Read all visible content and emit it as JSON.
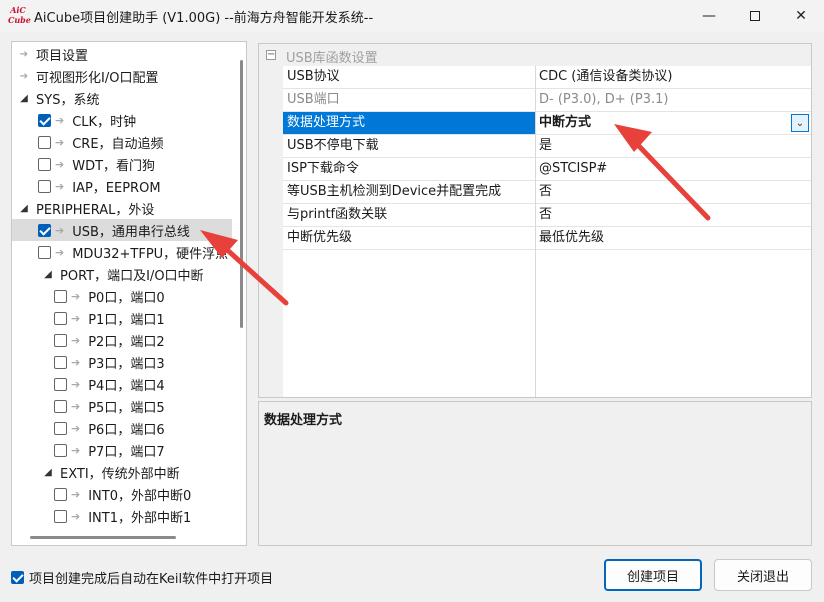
{
  "window": {
    "logo_top": "AiC",
    "logo_bottom": "Cube",
    "title": "AiCube项目创建助手 (V1.00G) --前海方舟智能开发系统--",
    "min_icon": "minimize-icon",
    "max_icon": "maximize-icon",
    "close_icon": "close-icon"
  },
  "tree": {
    "items": [
      {
        "label": "项目设置",
        "level": 0,
        "expander": "arrow",
        "checkbox": false
      },
      {
        "label": "可视图形化I/O口配置",
        "level": 0,
        "expander": "arrow",
        "checkbox": false
      },
      {
        "label": "SYS，系统",
        "level": 0,
        "expander": "open",
        "checkbox": false
      },
      {
        "label": "CLK，时钟",
        "level": 1,
        "checkbox": true,
        "checked": true
      },
      {
        "label": "CRE，自动追频",
        "level": 1,
        "checkbox": true,
        "checked": false
      },
      {
        "label": "WDT，看门狗",
        "level": 1,
        "checkbox": true,
        "checked": false
      },
      {
        "label": "IAP，EEPROM",
        "level": 1,
        "checkbox": true,
        "checked": false
      },
      {
        "label": "PERIPHERAL，外设",
        "level": 0,
        "expander": "open",
        "checkbox": false
      },
      {
        "label": "USB，通用串行总线",
        "level": 1,
        "checkbox": true,
        "checked": true,
        "selected": true
      },
      {
        "label": "MDU32+TFPU，硬件浮点",
        "level": 1,
        "checkbox": true,
        "checked": false
      },
      {
        "label": "PORT，端口及I/O口中断",
        "level": 2,
        "expander": "open",
        "checkbox": false
      },
      {
        "label": "P0口，端口0",
        "level": 3,
        "checkbox": true,
        "checked": false
      },
      {
        "label": "P1口，端口1",
        "level": 3,
        "checkbox": true,
        "checked": false
      },
      {
        "label": "P2口，端口2",
        "level": 3,
        "checkbox": true,
        "checked": false
      },
      {
        "label": "P3口，端口3",
        "level": 3,
        "checkbox": true,
        "checked": false
      },
      {
        "label": "P4口，端口4",
        "level": 3,
        "checkbox": true,
        "checked": false
      },
      {
        "label": "P5口，端口5",
        "level": 3,
        "checkbox": true,
        "checked": false
      },
      {
        "label": "P6口，端口6",
        "level": 3,
        "checkbox": true,
        "checked": false
      },
      {
        "label": "P7口，端口7",
        "level": 3,
        "checkbox": true,
        "checked": false
      },
      {
        "label": "EXTI，传统外部中断",
        "level": 2,
        "expander": "open",
        "checkbox": false
      },
      {
        "label": "INT0，外部中断0",
        "level": 3,
        "checkbox": true,
        "checked": false
      },
      {
        "label": "INT1，外部中断1",
        "level": 3,
        "checkbox": true,
        "checked": false
      }
    ]
  },
  "properties": {
    "category": "USB库函数设置",
    "rows": [
      {
        "key": "USB协议",
        "value": "CDC (通信设备类协议)",
        "state": "normal"
      },
      {
        "key": "USB端口",
        "value": "D- (P3.0), D+ (P3.1)",
        "state": "disabled"
      },
      {
        "key": "数据处理方式",
        "value": "中断方式",
        "state": "selected"
      },
      {
        "key": "USB不停电下载",
        "value": "是",
        "state": "normal"
      },
      {
        "key": "ISP下载命令",
        "value": "@STCISP#",
        "state": "normal"
      },
      {
        "key": "等USB主机检测到Device并配置完成",
        "value": "否",
        "state": "normal"
      },
      {
        "key": "与printf函数关联",
        "value": "否",
        "state": "normal"
      },
      {
        "key": "中断优先级",
        "value": "最低优先级",
        "state": "normal"
      }
    ],
    "dropdown_icon": "chevron-down-icon"
  },
  "description": {
    "title": "数据处理方式"
  },
  "footer": {
    "auto_open_label": "项目创建完成后自动在Keil软件中打开项目",
    "auto_open_checked": true,
    "create_button": "创建项目",
    "exit_button": "关闭退出"
  },
  "colors": {
    "accent": "#0078d7",
    "annotation": "#e8403a"
  }
}
